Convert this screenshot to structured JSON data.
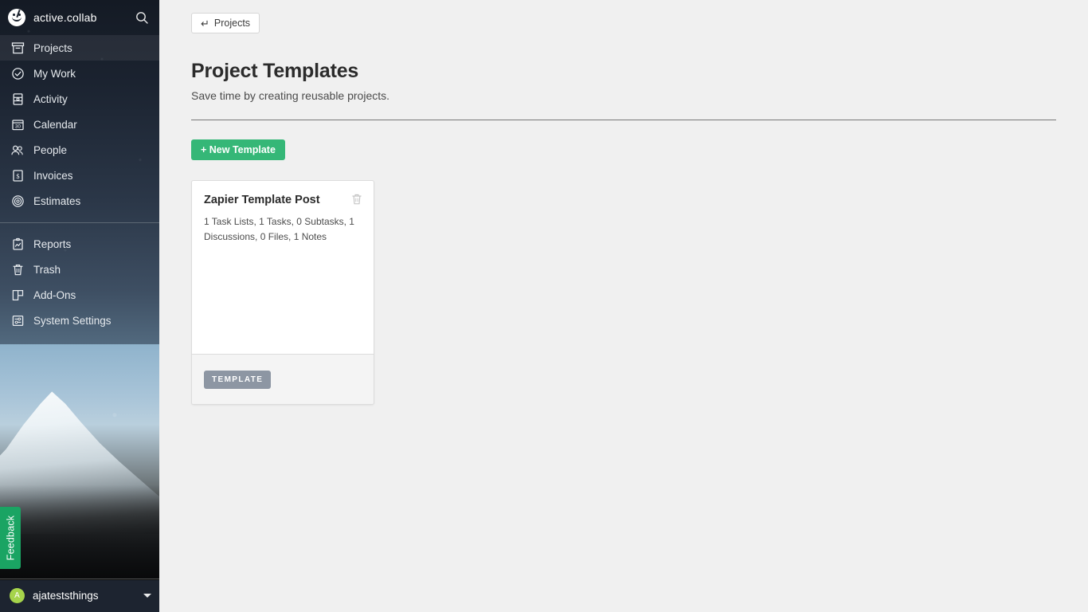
{
  "sidebar": {
    "brand": {
      "name": "active.collab",
      "logo_icon": "activecollab-smiley-logo",
      "search_icon": "search-icon"
    },
    "groups": [
      {
        "items": [
          {
            "label": "Projects",
            "icon": "archive-box-icon",
            "active": true
          },
          {
            "label": "My Work",
            "icon": "check-circle-icon",
            "active": false
          },
          {
            "label": "Activity",
            "icon": "activity-pulse-icon",
            "active": false
          },
          {
            "label": "Calendar",
            "icon": "calendar-30-icon",
            "active": false
          },
          {
            "label": "People",
            "icon": "people-icon",
            "active": false
          },
          {
            "label": "Invoices",
            "icon": "dollar-document-icon",
            "active": false
          },
          {
            "label": "Estimates",
            "icon": "target-circles-icon",
            "active": false
          }
        ]
      },
      {
        "items": [
          {
            "label": "Reports",
            "icon": "clipboard-chart-icon",
            "active": false
          },
          {
            "label": "Trash",
            "icon": "trash-icon",
            "active": false
          },
          {
            "label": "Add-Ons",
            "icon": "pages-stack-icon",
            "active": false
          },
          {
            "label": "System Settings",
            "icon": "sliders-settings-icon",
            "active": false
          }
        ]
      }
    ],
    "feedback": {
      "label": "Feedback",
      "color": "#1aa463"
    },
    "user": {
      "initial": "A",
      "name": "ajateststhings",
      "avatar_color": "#a6d44b",
      "caret_icon": "chevron-down-icon"
    }
  },
  "main": {
    "back_button": {
      "label": "Projects",
      "icon": "return-arrow-icon"
    },
    "title": "Project Templates",
    "subtitle": "Save time by creating reusable projects.",
    "new_template_button": {
      "label": "+ New Template",
      "color": "#35b777"
    },
    "templates": [
      {
        "title": "Zapier Template Post",
        "meta": "1 Task Lists, 1 Tasks, 0 Subtasks, 1 Discussions, 0 Files, 1 Notes",
        "badge": "TEMPLATE",
        "delete_icon": "trash-icon"
      }
    ]
  }
}
